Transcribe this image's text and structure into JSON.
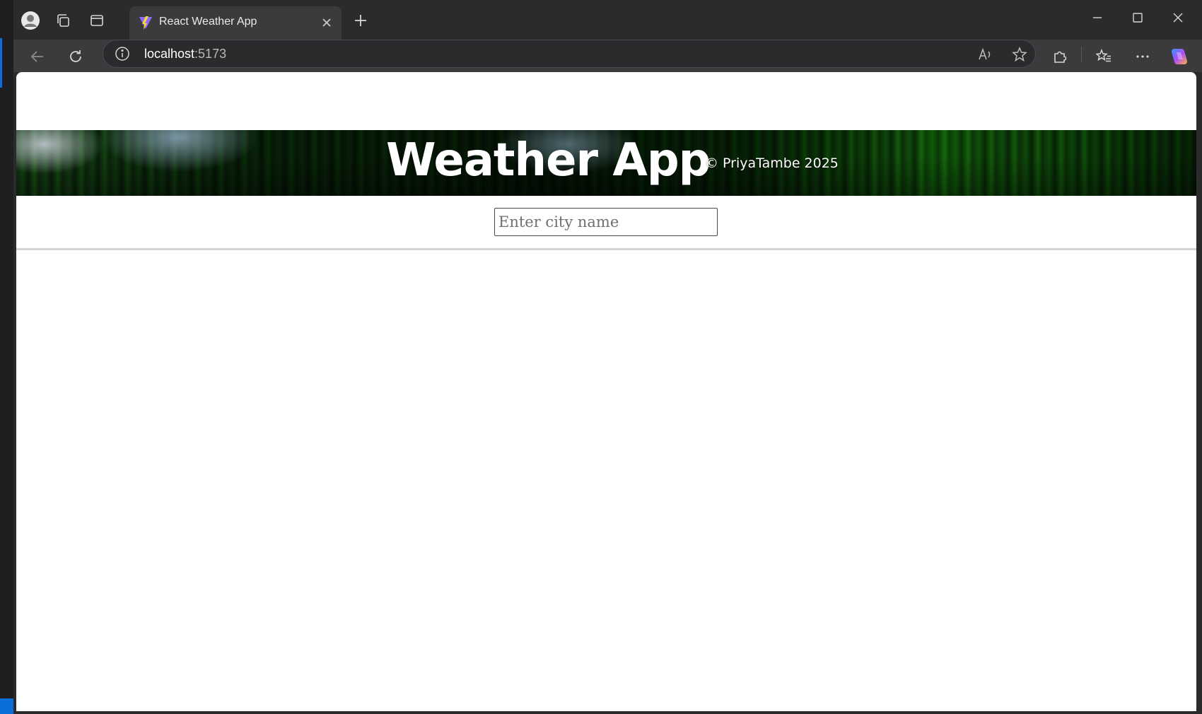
{
  "browser": {
    "tab_title": "React Weather App",
    "address": {
      "host": "localhost",
      "port": ":5173"
    },
    "icons": {
      "profile": "profile-icon",
      "workspaces": "workspaces-icon",
      "vertical_tabs": "vertical-tabs-icon",
      "favicon": "vite-favicon-icon",
      "close_tab": "close-icon",
      "new_tab": "plus-icon",
      "minimize": "minimize-icon",
      "maximize": "maximize-icon",
      "close_window": "close-window-icon",
      "back": "back-arrow-icon",
      "refresh": "refresh-icon",
      "site_info": "info-icon",
      "read_aloud": "read-aloud-icon",
      "favorite": "star-icon",
      "extensions": "puzzle-icon",
      "favorites": "favorites-list-icon",
      "more": "more-dots-icon",
      "copilot": "copilot-icon"
    }
  },
  "page": {
    "title": "Weather App",
    "copyright": "© PriyaTambe 2025",
    "search": {
      "placeholder": "Enter city name",
      "value": ""
    }
  },
  "colors": {
    "page_background": "#ffffff",
    "browser_chrome": "#2b2b2e",
    "toolbar": "#3b3b3e",
    "title_text": "#ffffff",
    "divider": "#d4d4d4"
  }
}
